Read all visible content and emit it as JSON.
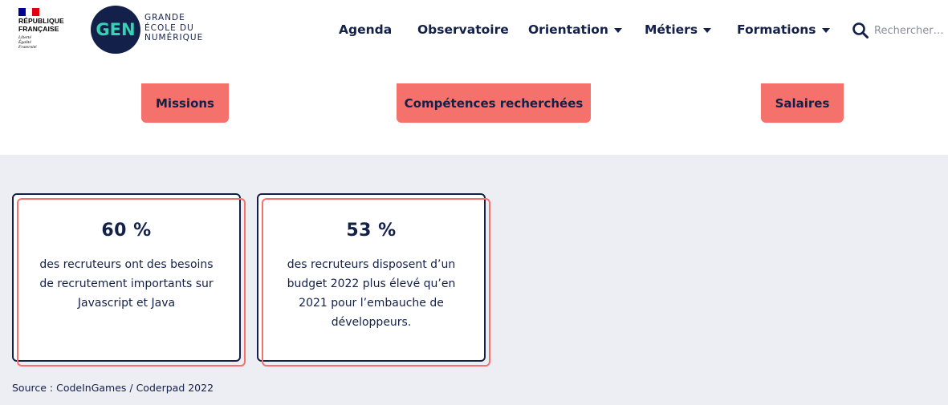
{
  "header": {
    "republic": {
      "title_lines": [
        "RÉPUBLIQUE",
        "FRANÇAISE"
      ],
      "motto_lines": [
        "Liberté",
        "Égalité",
        "Fraternité"
      ],
      "flag_colors": [
        "#000091",
        "#ffffff",
        "#e1000f"
      ]
    },
    "logo": {
      "initials": "GEN",
      "lines": [
        "GRANDE",
        "ÉCOLE DU",
        "NUMÉRIQUE"
      ]
    },
    "nav": [
      {
        "label": "Agenda",
        "dropdown": false
      },
      {
        "label": "Observatoire",
        "dropdown": false
      },
      {
        "label": "Orientation",
        "dropdown": true
      },
      {
        "label": "Métiers",
        "dropdown": true
      },
      {
        "label": "Formations",
        "dropdown": true
      }
    ],
    "search": {
      "placeholder": "Rechercher…",
      "value": ""
    }
  },
  "tabs": [
    {
      "label": "Missions"
    },
    {
      "label": "Compétences recherchées"
    },
    {
      "label": "Salaires"
    }
  ],
  "stats": [
    {
      "value": "60 %",
      "description": "des recruteurs ont des besoins de recrutement importants sur Javascript et Java"
    },
    {
      "value": "53 %",
      "description": "des recruteurs disposent d’un budget 2022 plus élevé qu’en 2021 pour l’embauche de développeurs."
    }
  ],
  "source": "Source : CodeInGames / Coderpad 2022",
  "colors": {
    "navy": "#13204a",
    "coral": "#f5716c",
    "teal": "#36d3b3",
    "section_bg": "#eceef3"
  }
}
